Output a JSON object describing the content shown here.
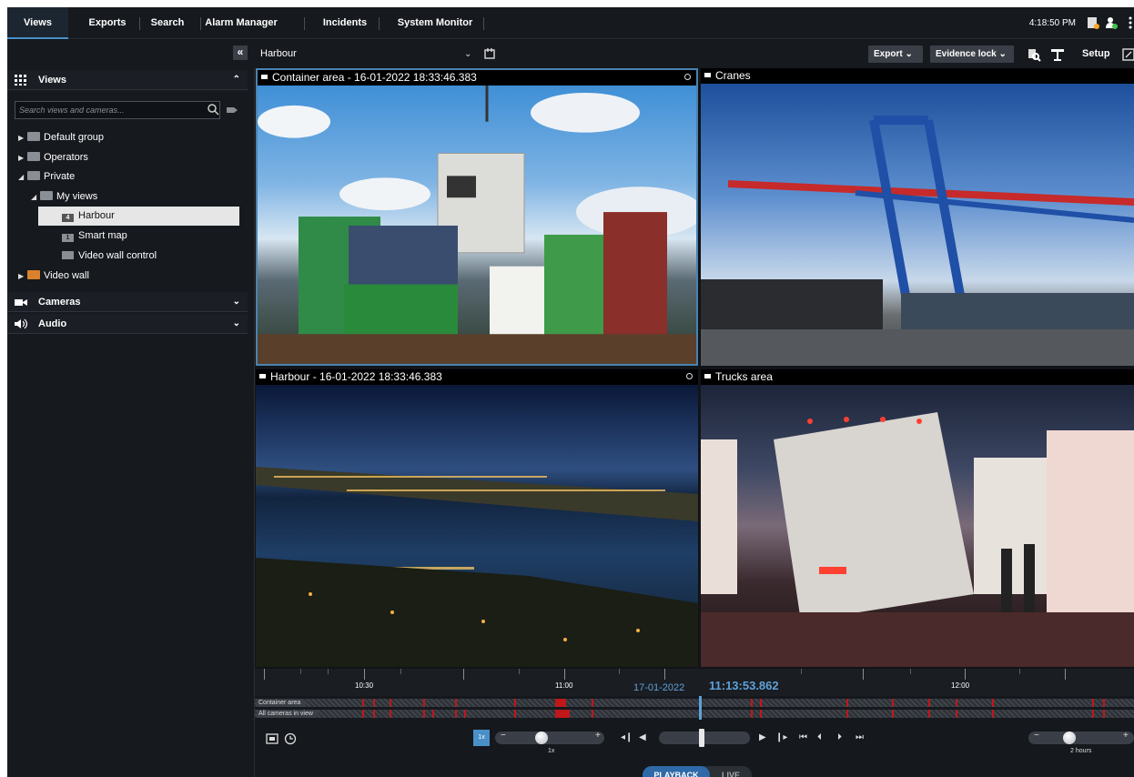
{
  "tabs": [
    {
      "label": "Views",
      "active": true
    },
    {
      "label": "Exports"
    },
    {
      "label": "Search"
    },
    {
      "label": "Alarm Manager"
    },
    {
      "label": "Incidents"
    },
    {
      "label": "System Monitor"
    }
  ],
  "header": {
    "clock": "4:18:50 PM"
  },
  "toolbar": {
    "view_name": "Harbour",
    "export_label": "Export",
    "evidence_lock_label": "Evidence lock",
    "setup_label": "Setup"
  },
  "sidebar": {
    "views_title": "Views",
    "search_placeholder": "Search views and cameras...",
    "tree": [
      {
        "label": "Default group"
      },
      {
        "label": "Operators"
      },
      {
        "label": "Private"
      },
      {
        "label": "My views"
      },
      {
        "label": "Harbour",
        "icon_text": "4"
      },
      {
        "label": "Smart map",
        "icon_text": "1"
      },
      {
        "label": "Video wall control"
      },
      {
        "label": "Video wall"
      }
    ],
    "cameras_title": "Cameras",
    "audio_title": "Audio"
  },
  "tiles": [
    {
      "title": "Container area - 16-01-2022 18:33:46.383"
    },
    {
      "title": "Cranes"
    },
    {
      "title": "Harbour - 16-01-2022 18:33:46.383"
    },
    {
      "title": "Trucks area"
    }
  ],
  "timeline": {
    "ticks": [
      "10:30",
      "11:00",
      "12:00"
    ],
    "date": "17-01-2022",
    "current_time": "11:13:53.862",
    "tracks": [
      "Container area",
      "All cameras in view"
    ],
    "speed_badge": "1x",
    "speed_label": "1x",
    "span_label": "2 hours",
    "playback_label": "PLAYBACK",
    "live_label": "LIVE"
  },
  "colors": {
    "accent": "#4a90c8",
    "recording": "#c0171b"
  }
}
